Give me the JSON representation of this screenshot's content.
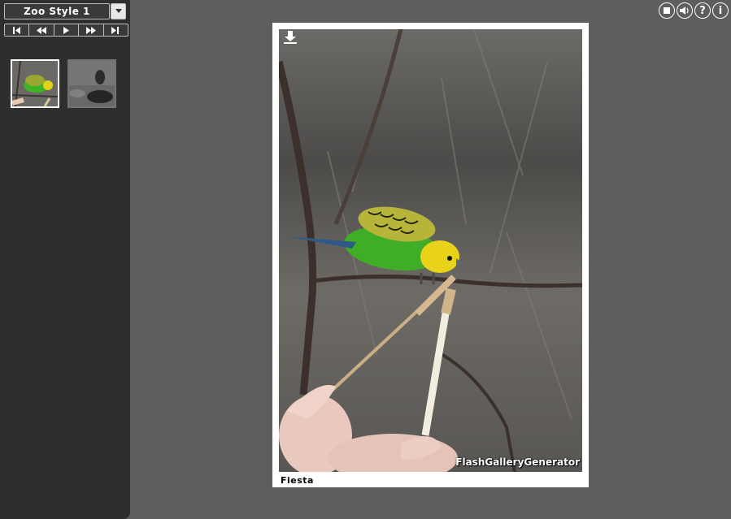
{
  "sidebar": {
    "album": {
      "selected": "Zoo Style 1"
    },
    "controls": [
      {
        "icon": "first-icon"
      },
      {
        "icon": "rewind-icon"
      },
      {
        "icon": "play-icon"
      },
      {
        "icon": "fast-forward-icon"
      },
      {
        "icon": "last-icon"
      }
    ],
    "thumbnails": [
      {
        "subject": "budgie",
        "active": true
      },
      {
        "subject": "duck",
        "active": false
      }
    ]
  },
  "top_buttons": [
    {
      "icon": "stop-icon"
    },
    {
      "icon": "sound-icon"
    },
    {
      "icon": "help-icon",
      "glyph": "?"
    },
    {
      "icon": "info-icon",
      "glyph": "i"
    }
  ],
  "viewer": {
    "caption": "Fiesta",
    "watermark": "FlashGalleryGenerator",
    "download_icon": "download-icon"
  },
  "colors": {
    "background": "#5e5e5e",
    "sidebar": "#2e2e2e",
    "frame": "#ffffff"
  }
}
